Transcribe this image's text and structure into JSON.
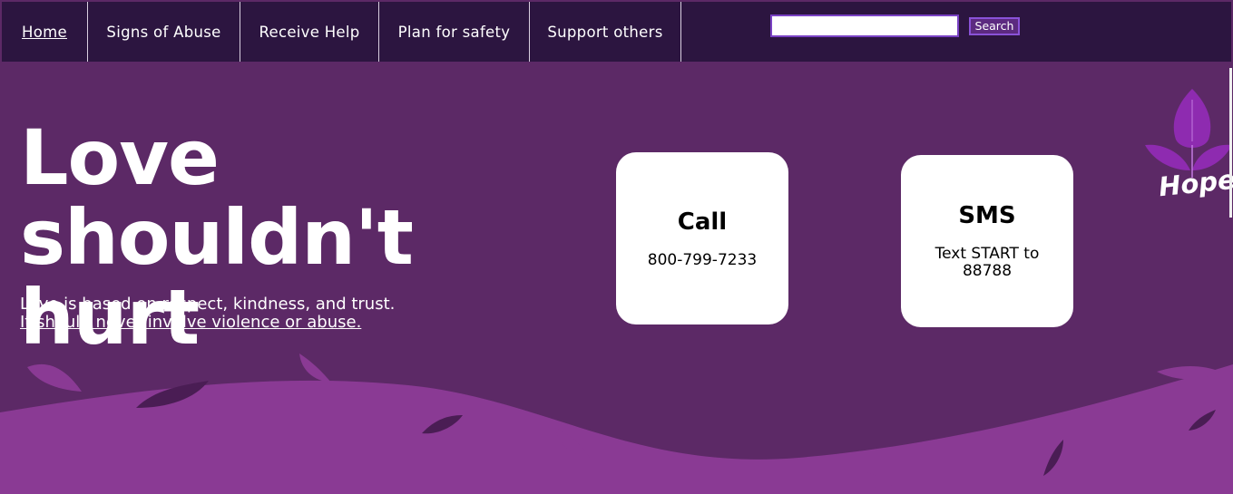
{
  "nav": {
    "items": [
      {
        "label": "Home"
      },
      {
        "label": "Signs of Abuse"
      },
      {
        "label": "Receive Help"
      },
      {
        "label": "Plan for safety"
      },
      {
        "label": "Support others"
      }
    ]
  },
  "search": {
    "placeholder": "",
    "button_label": "Search"
  },
  "hero": {
    "title": "Love shouldn't hurt",
    "subtitle_line1": "Love is based on respect, kindness, and trust.",
    "subtitle_line2": "It should never involve violence or abuse."
  },
  "cards": [
    {
      "title": "Call",
      "text": "800-799-7233"
    },
    {
      "title": "SMS",
      "text": "Text START to 88788"
    }
  ],
  "logo": {
    "text": "Hope"
  },
  "colors": {
    "background": "#5c2966",
    "navbar": "#2c1540",
    "accent": "#8a3a94",
    "logo_leaf": "#8e2bb0"
  }
}
